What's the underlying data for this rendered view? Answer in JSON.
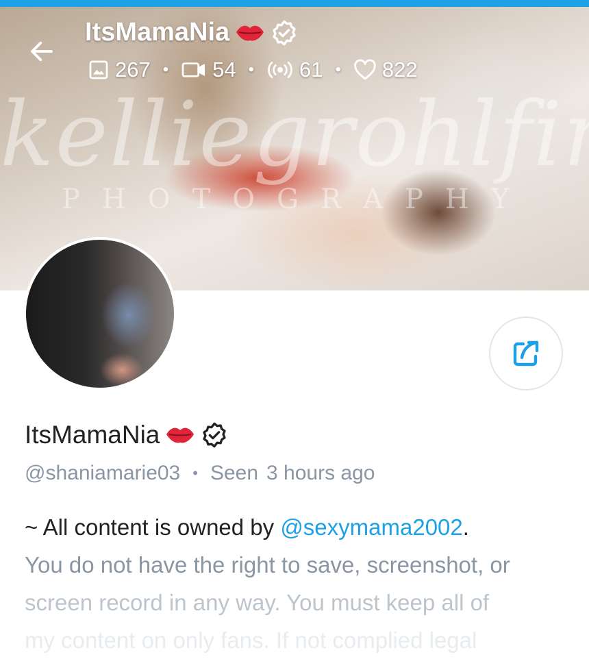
{
  "header": {
    "name": "ItsMamaNia",
    "stats": {
      "photos": "267",
      "videos": "54",
      "streams": "61",
      "likes": "822"
    }
  },
  "cover": {
    "watermark_script": "kelliegrohlfing",
    "watermark_sub": "PHOTOGRAPHY"
  },
  "profile": {
    "name": "ItsMamaNia",
    "handle": "@shaniamarie03",
    "seen_label": "Seen",
    "seen_time": "3 hours ago"
  },
  "bio": {
    "line1_prefix": "~ All content is owned by ",
    "line1_mention": "@sexymama2002",
    "line1_suffix": ".",
    "line2": "You do not have the right to save, screenshot, or",
    "line3": "screen record in any way. You must keep all of",
    "line4": "my content on only fans. If not complied legal"
  },
  "colors": {
    "accent": "#1da1e6",
    "muted": "#8a96a3"
  },
  "icons": {
    "back": "arrow-left-icon",
    "verified": "verified-badge-icon",
    "kiss": "kiss-lips-icon",
    "photos": "image-icon",
    "videos": "video-icon",
    "streams": "broadcast-icon",
    "likes": "heart-icon",
    "share": "share-icon"
  }
}
